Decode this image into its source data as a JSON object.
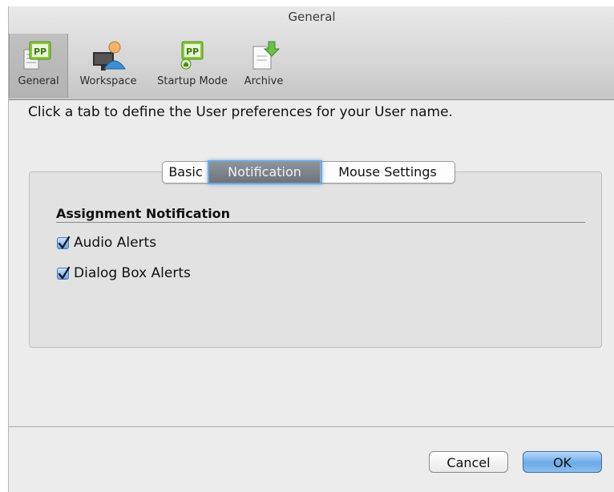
{
  "window": {
    "title": "General"
  },
  "toolbar": {
    "items": [
      {
        "label": "General",
        "icon": "general-pp-icon",
        "selected": true
      },
      {
        "label": "Workspace",
        "icon": "workspace-user-icon",
        "selected": false
      },
      {
        "label": "Startup Mode",
        "icon": "startup-pp-icon",
        "selected": false
      },
      {
        "label": "Archive",
        "icon": "archive-download-icon",
        "selected": false
      }
    ]
  },
  "instruction": "Click a tab to define the User preferences for your User name.",
  "tabs": [
    {
      "label": "Basic",
      "active": false
    },
    {
      "label": "Notification",
      "active": true
    },
    {
      "label": "Mouse Settings",
      "active": false
    }
  ],
  "section": {
    "title": "Assignment Notification",
    "options": [
      {
        "label": "Audio Alerts",
        "checked": true
      },
      {
        "label": "Dialog Box Alerts",
        "checked": true
      }
    ]
  },
  "buttons": {
    "cancel": "Cancel",
    "ok": "OK"
  },
  "colors": {
    "accent": "#6aa9e8",
    "active_tab": "#7a8087",
    "pp_green": "#7fbf3f"
  }
}
